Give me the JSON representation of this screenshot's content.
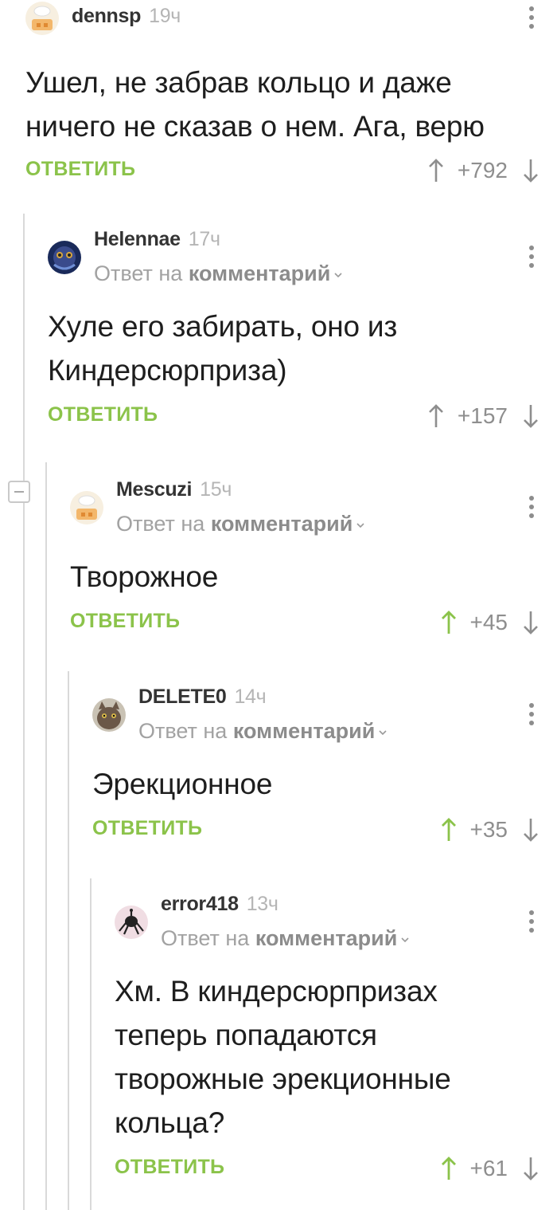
{
  "comments": [
    {
      "author": "dennsp",
      "time": "19ч",
      "reply_prefix": "",
      "reply_target": "",
      "text": "Ушел, не забрав кольцо и даже ничего не сказав о нем. Ага, верю",
      "reply_label": "ОТВЕТИТЬ",
      "rating": "+792",
      "up_voted": false
    },
    {
      "author": "Helennae",
      "time": "17ч",
      "reply_prefix": "Ответ на",
      "reply_target": "комментарий",
      "text": "Хуле его забирать, оно из Киндерсюрприза)",
      "reply_label": "ОТВЕТИТЬ",
      "rating": "+157",
      "up_voted": false
    },
    {
      "author": "Mescuzi",
      "time": "15ч",
      "reply_prefix": "Ответ на",
      "reply_target": "комментарий",
      "text": "Творожное",
      "reply_label": "ОТВЕТИТЬ",
      "rating": "+45",
      "up_voted": true
    },
    {
      "author": "DELETE0",
      "time": "14ч",
      "reply_prefix": "Ответ на",
      "reply_target": "комментарий",
      "text": "Эрекционное",
      "reply_label": "ОТВЕТИТЬ",
      "rating": "+35",
      "up_voted": true
    },
    {
      "author": "error418",
      "time": "13ч",
      "reply_prefix": "Ответ на",
      "reply_target": "комментарий",
      "text": "Хм. В киндерсюрпризах теперь попадаются творожные эрекционные кольца?",
      "reply_label": "ОТВЕТИТЬ",
      "rating": "+61",
      "up_voted": true
    }
  ],
  "icons": {
    "menu": "more-vertical-icon",
    "upvote": "arrow-up-icon",
    "downvote": "arrow-down-icon",
    "chevron": "chevron-down-icon",
    "collapse": "collapse-minus-icon"
  },
  "colors": {
    "accent_green": "#8bc34a",
    "grey_text": "#a2a2a2",
    "thread_line": "#d9d9d9"
  }
}
